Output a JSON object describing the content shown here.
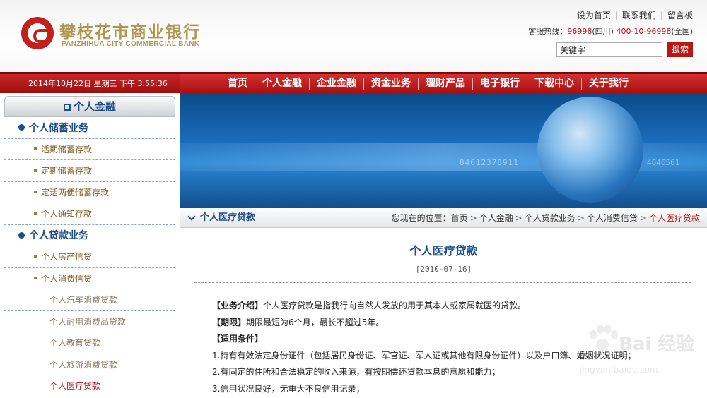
{
  "header": {
    "bank_name_cn": "攀枝花市商业银行",
    "bank_name_en": "PANZHIHUA CITY COMMERCIAL BANK",
    "top_links": [
      "设为首页",
      "联系我们",
      "留言板"
    ],
    "hotline_label": "客服热线：",
    "hotline_1": "96998",
    "hotline_1_region": "(四川)",
    "hotline_2": "400-10-96998",
    "hotline_2_region": "(全国)",
    "search_value": "关键字",
    "search_button": "搜索"
  },
  "navbar": {
    "datetime": "2014年10月22日 星期三 下午 3:55:36",
    "items": [
      "首页",
      "个人金融",
      "企业金融",
      "资金业务",
      "理财产品",
      "电子银行",
      "下载中心",
      "关于我行"
    ]
  },
  "sidebar": {
    "heading": "个人金融",
    "items": [
      {
        "label": "个人储蓄业务",
        "level": "cat"
      },
      {
        "label": "活期储蓄存款",
        "level": "sub"
      },
      {
        "label": "定期储蓄存款",
        "level": "sub"
      },
      {
        "label": "定活两便储蓄存款",
        "level": "sub"
      },
      {
        "label": "个人通知存款",
        "level": "sub"
      },
      {
        "label": "个人贷款业务",
        "level": "cat"
      },
      {
        "label": "个人房产信贷",
        "level": "sub"
      },
      {
        "label": "个人消费信贷",
        "level": "sub"
      },
      {
        "label": "个人汽车消费贷款",
        "level": "sub2"
      },
      {
        "label": "个人耐用消费品贷款",
        "level": "sub2"
      },
      {
        "label": "个人教育贷款",
        "level": "sub2"
      },
      {
        "label": "个人旅游消费贷款",
        "level": "sub2"
      },
      {
        "label": "个人医疗贷款",
        "level": "sub2",
        "active": true
      }
    ]
  },
  "banner": {
    "digits": "84612378911",
    "digits2": "4846561"
  },
  "breadcrumb": {
    "section_title": "个人医疗贷款",
    "location_label": "您现在的位置：",
    "path": [
      "首页",
      "个人金融",
      "个人贷款业务",
      "个人消费信贷"
    ],
    "current": "个人医疗贷款"
  },
  "article": {
    "title": "个人医疗贷款",
    "date": "[2010-07-16]",
    "intro_label": "【业务介绍】",
    "intro_text": "个人医疗贷款是指我行向自然人发放的用于其本人或家属就医的贷款。",
    "term_label": "【期限】",
    "term_text": "期限最短为6个月，最长不超过5年。",
    "conditions_label": "【适用条件】",
    "conditions": [
      "1.持有有效法定身份证件（包括居民身份证、军官证、军人证或其他有限身份证件）以及户口簿、婚姻状况证明；",
      "2.有固定的住所和合法稳定的收入来源，有按期偿还贷款本息的意愿和能力；",
      "3.信用状况良好，无重大不良信用记录；"
    ]
  },
  "watermark": {
    "text": "Bai 经验",
    "url": "jingyan.baidu.com"
  },
  "colors": {
    "brand_red": "#b81717",
    "brand_gold": "#b2964f",
    "link_blue": "#1d4e8a",
    "active_red": "#b51a1a"
  }
}
